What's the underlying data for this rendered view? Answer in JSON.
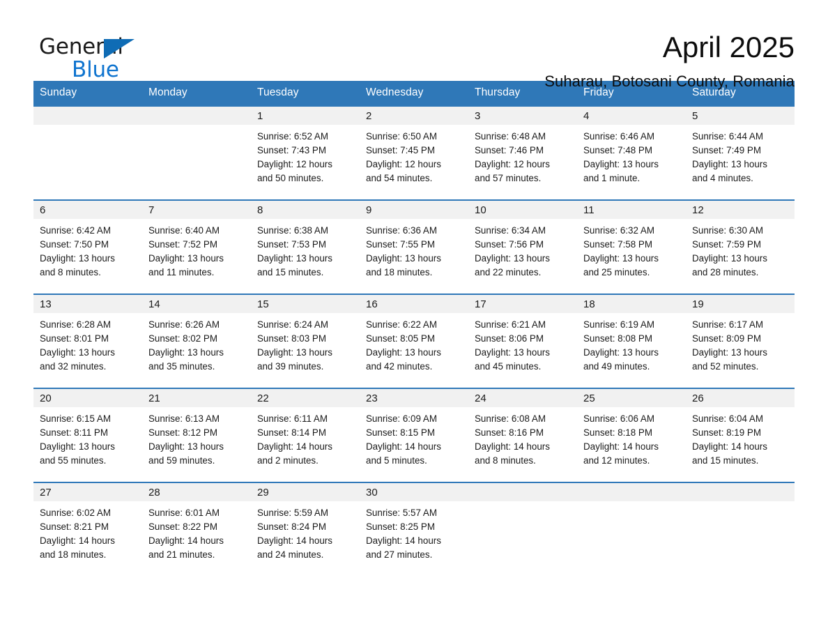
{
  "brand": {
    "name_part1": "General",
    "name_part2": "Blue",
    "triangle_color": "#0f6cb5",
    "blue_color": "#0f74cf"
  },
  "header": {
    "title": "April 2025",
    "location": "Suharau, Botosani County, Romania"
  },
  "theme": {
    "header_blue": "#2f78b8",
    "daynum_band": "#f1f1f1",
    "text": "#1a1a1a"
  },
  "calendar": {
    "weekday_headers": [
      "Sunday",
      "Monday",
      "Tuesday",
      "Wednesday",
      "Thursday",
      "Friday",
      "Saturday"
    ],
    "weeks": [
      [
        {
          "day": "",
          "empty": true
        },
        {
          "day": "",
          "empty": true
        },
        {
          "day": "1",
          "sunrise": "Sunrise: 6:52 AM",
          "sunset": "Sunset: 7:43 PM",
          "daylight_line1": "Daylight: 12 hours",
          "daylight_line2": "and 50 minutes."
        },
        {
          "day": "2",
          "sunrise": "Sunrise: 6:50 AM",
          "sunset": "Sunset: 7:45 PM",
          "daylight_line1": "Daylight: 12 hours",
          "daylight_line2": "and 54 minutes."
        },
        {
          "day": "3",
          "sunrise": "Sunrise: 6:48 AM",
          "sunset": "Sunset: 7:46 PM",
          "daylight_line1": "Daylight: 12 hours",
          "daylight_line2": "and 57 minutes."
        },
        {
          "day": "4",
          "sunrise": "Sunrise: 6:46 AM",
          "sunset": "Sunset: 7:48 PM",
          "daylight_line1": "Daylight: 13 hours",
          "daylight_line2": "and 1 minute."
        },
        {
          "day": "5",
          "sunrise": "Sunrise: 6:44 AM",
          "sunset": "Sunset: 7:49 PM",
          "daylight_line1": "Daylight: 13 hours",
          "daylight_line2": "and 4 minutes."
        }
      ],
      [
        {
          "day": "6",
          "sunrise": "Sunrise: 6:42 AM",
          "sunset": "Sunset: 7:50 PM",
          "daylight_line1": "Daylight: 13 hours",
          "daylight_line2": "and 8 minutes."
        },
        {
          "day": "7",
          "sunrise": "Sunrise: 6:40 AM",
          "sunset": "Sunset: 7:52 PM",
          "daylight_line1": "Daylight: 13 hours",
          "daylight_line2": "and 11 minutes."
        },
        {
          "day": "8",
          "sunrise": "Sunrise: 6:38 AM",
          "sunset": "Sunset: 7:53 PM",
          "daylight_line1": "Daylight: 13 hours",
          "daylight_line2": "and 15 minutes."
        },
        {
          "day": "9",
          "sunrise": "Sunrise: 6:36 AM",
          "sunset": "Sunset: 7:55 PM",
          "daylight_line1": "Daylight: 13 hours",
          "daylight_line2": "and 18 minutes."
        },
        {
          "day": "10",
          "sunrise": "Sunrise: 6:34 AM",
          "sunset": "Sunset: 7:56 PM",
          "daylight_line1": "Daylight: 13 hours",
          "daylight_line2": "and 22 minutes."
        },
        {
          "day": "11",
          "sunrise": "Sunrise: 6:32 AM",
          "sunset": "Sunset: 7:58 PM",
          "daylight_line1": "Daylight: 13 hours",
          "daylight_line2": "and 25 minutes."
        },
        {
          "day": "12",
          "sunrise": "Sunrise: 6:30 AM",
          "sunset": "Sunset: 7:59 PM",
          "daylight_line1": "Daylight: 13 hours",
          "daylight_line2": "and 28 minutes."
        }
      ],
      [
        {
          "day": "13",
          "sunrise": "Sunrise: 6:28 AM",
          "sunset": "Sunset: 8:01 PM",
          "daylight_line1": "Daylight: 13 hours",
          "daylight_line2": "and 32 minutes."
        },
        {
          "day": "14",
          "sunrise": "Sunrise: 6:26 AM",
          "sunset": "Sunset: 8:02 PM",
          "daylight_line1": "Daylight: 13 hours",
          "daylight_line2": "and 35 minutes."
        },
        {
          "day": "15",
          "sunrise": "Sunrise: 6:24 AM",
          "sunset": "Sunset: 8:03 PM",
          "daylight_line1": "Daylight: 13 hours",
          "daylight_line2": "and 39 minutes."
        },
        {
          "day": "16",
          "sunrise": "Sunrise: 6:22 AM",
          "sunset": "Sunset: 8:05 PM",
          "daylight_line1": "Daylight: 13 hours",
          "daylight_line2": "and 42 minutes."
        },
        {
          "day": "17",
          "sunrise": "Sunrise: 6:21 AM",
          "sunset": "Sunset: 8:06 PM",
          "daylight_line1": "Daylight: 13 hours",
          "daylight_line2": "and 45 minutes."
        },
        {
          "day": "18",
          "sunrise": "Sunrise: 6:19 AM",
          "sunset": "Sunset: 8:08 PM",
          "daylight_line1": "Daylight: 13 hours",
          "daylight_line2": "and 49 minutes."
        },
        {
          "day": "19",
          "sunrise": "Sunrise: 6:17 AM",
          "sunset": "Sunset: 8:09 PM",
          "daylight_line1": "Daylight: 13 hours",
          "daylight_line2": "and 52 minutes."
        }
      ],
      [
        {
          "day": "20",
          "sunrise": "Sunrise: 6:15 AM",
          "sunset": "Sunset: 8:11 PM",
          "daylight_line1": "Daylight: 13 hours",
          "daylight_line2": "and 55 minutes."
        },
        {
          "day": "21",
          "sunrise": "Sunrise: 6:13 AM",
          "sunset": "Sunset: 8:12 PM",
          "daylight_line1": "Daylight: 13 hours",
          "daylight_line2": "and 59 minutes."
        },
        {
          "day": "22",
          "sunrise": "Sunrise: 6:11 AM",
          "sunset": "Sunset: 8:14 PM",
          "daylight_line1": "Daylight: 14 hours",
          "daylight_line2": "and 2 minutes."
        },
        {
          "day": "23",
          "sunrise": "Sunrise: 6:09 AM",
          "sunset": "Sunset: 8:15 PM",
          "daylight_line1": "Daylight: 14 hours",
          "daylight_line2": "and 5 minutes."
        },
        {
          "day": "24",
          "sunrise": "Sunrise: 6:08 AM",
          "sunset": "Sunset: 8:16 PM",
          "daylight_line1": "Daylight: 14 hours",
          "daylight_line2": "and 8 minutes."
        },
        {
          "day": "25",
          "sunrise": "Sunrise: 6:06 AM",
          "sunset": "Sunset: 8:18 PM",
          "daylight_line1": "Daylight: 14 hours",
          "daylight_line2": "and 12 minutes."
        },
        {
          "day": "26",
          "sunrise": "Sunrise: 6:04 AM",
          "sunset": "Sunset: 8:19 PM",
          "daylight_line1": "Daylight: 14 hours",
          "daylight_line2": "and 15 minutes."
        }
      ],
      [
        {
          "day": "27",
          "sunrise": "Sunrise: 6:02 AM",
          "sunset": "Sunset: 8:21 PM",
          "daylight_line1": "Daylight: 14 hours",
          "daylight_line2": "and 18 minutes."
        },
        {
          "day": "28",
          "sunrise": "Sunrise: 6:01 AM",
          "sunset": "Sunset: 8:22 PM",
          "daylight_line1": "Daylight: 14 hours",
          "daylight_line2": "and 21 minutes."
        },
        {
          "day": "29",
          "sunrise": "Sunrise: 5:59 AM",
          "sunset": "Sunset: 8:24 PM",
          "daylight_line1": "Daylight: 14 hours",
          "daylight_line2": "and 24 minutes."
        },
        {
          "day": "30",
          "sunrise": "Sunrise: 5:57 AM",
          "sunset": "Sunset: 8:25 PM",
          "daylight_line1": "Daylight: 14 hours",
          "daylight_line2": "and 27 minutes."
        },
        {
          "day": "",
          "empty": true
        },
        {
          "day": "",
          "empty": true
        },
        {
          "day": "",
          "empty": true
        }
      ]
    ]
  }
}
